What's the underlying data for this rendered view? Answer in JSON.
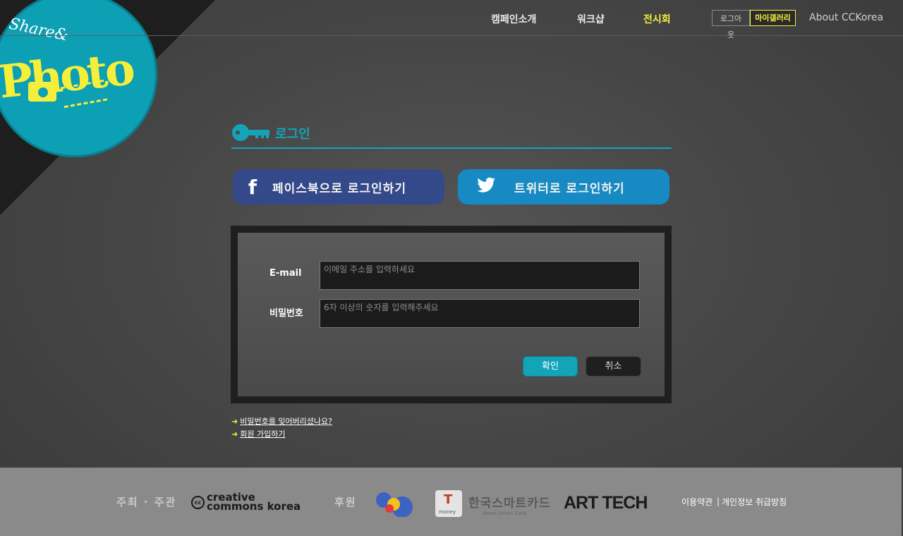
{
  "logo": {
    "line1": "Share&",
    "line2": "Photo"
  },
  "nav": {
    "campaign": "캠페인소개",
    "workshop": "워크샵",
    "exhibition": "전시회",
    "logout": "로그아웃",
    "my_gallery": "마이갤러리",
    "about": "About CCKorea"
  },
  "login": {
    "title": "로그인",
    "facebook": "페이스북으로 로그인하기",
    "twitter": "트위터로 로그인하기",
    "email_label": "E-mail",
    "email_placeholder": "이메일 주소를 입력하세요",
    "password_label": "비밀번호",
    "password_placeholder": "6자 이상의 숫자를 입력해주세요",
    "ok": "확인",
    "cancel": "취소",
    "forgot": "비밀번호를 잊어버리셨나요?",
    "signup": "회원 가입하기"
  },
  "footer": {
    "host_label": "주최 · 주관",
    "cc_line1": "creative",
    "cc_line2": "commons korea",
    "sponsor_label": "후원",
    "tmoney": "money",
    "smartcard": "한국스마트카드",
    "smartcard_en": "Korea Smart Card",
    "arttech": "ART TECH",
    "terms": "이용약관",
    "privacy": "개인정보 취급방침"
  },
  "colors": {
    "accent": "#14a4b8",
    "highlight": "#f5ef3c",
    "facebook": "#34498a",
    "twitter": "#178ac3"
  }
}
